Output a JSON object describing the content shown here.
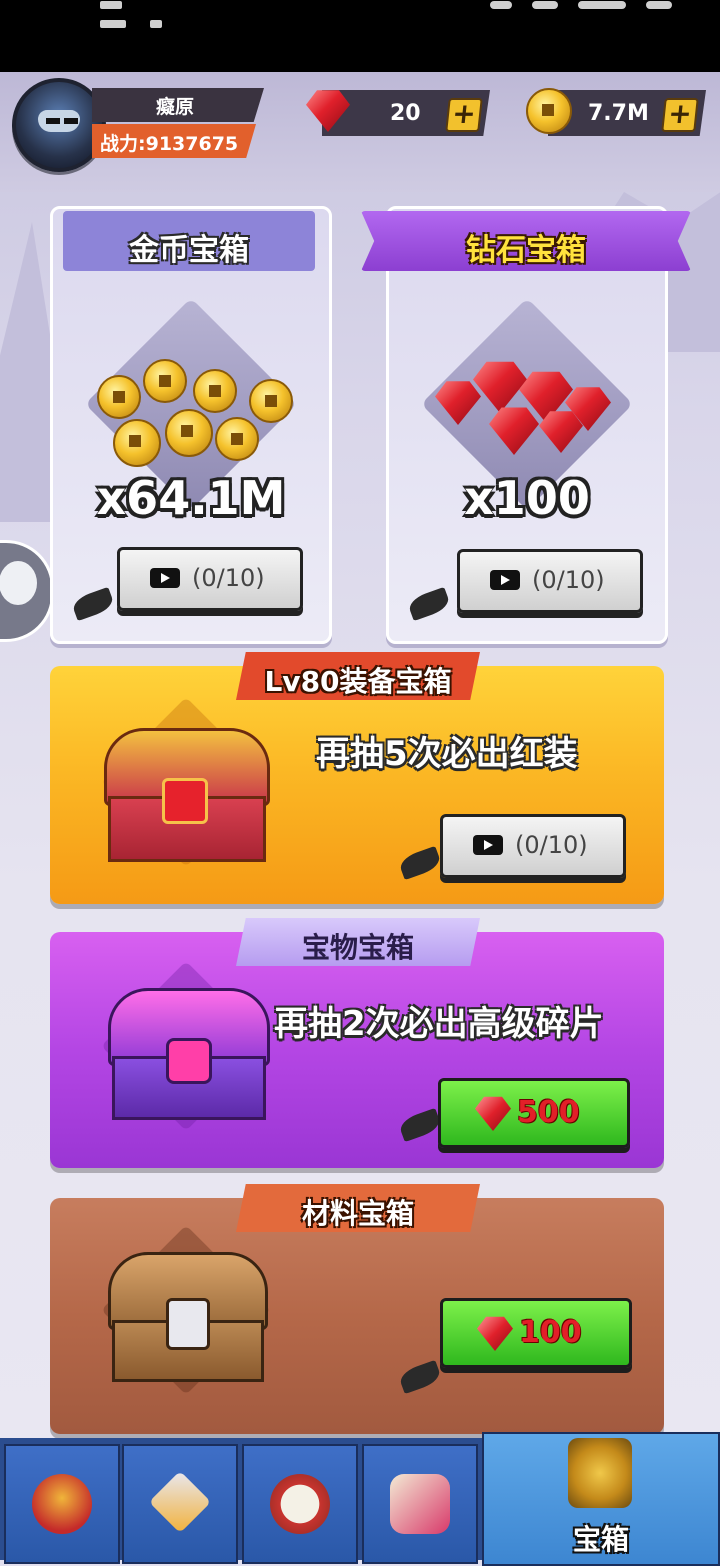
{
  "player": {
    "name": "癡原",
    "power": "战力:9137675"
  },
  "resources": {
    "gems": "20",
    "coins": "7.7M",
    "plus": "+"
  },
  "cards": {
    "gold": {
      "title": "金币宝箱",
      "quantity": "x64.1M",
      "video": "(0/10)"
    },
    "diamond": {
      "title": "钻石宝箱",
      "quantity": "x100",
      "video": "(0/10)"
    }
  },
  "chests": {
    "equipment": {
      "banner": "Lv80装备宝箱",
      "promo": "再抽5次必出红装",
      "video": "(0/10)"
    },
    "treasure": {
      "banner": "宝物宝箱",
      "promo": "再抽2次必出高级碎片",
      "price": "500"
    },
    "material": {
      "banner": "材料宝箱",
      "price": "100"
    }
  },
  "nav": {
    "active_label": "宝箱"
  },
  "colors": {
    "accent": "#f2c12d",
    "gem": "#e0202b",
    "green": "#2fb81e"
  }
}
